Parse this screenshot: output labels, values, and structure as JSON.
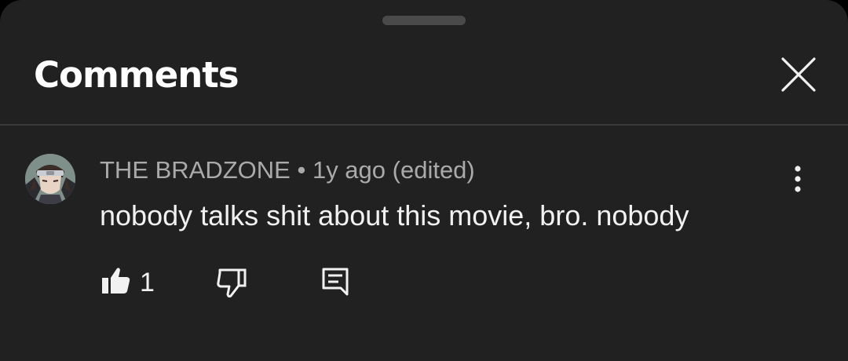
{
  "header": {
    "title": "Comments"
  },
  "icons": {
    "close": "close-icon",
    "more": "more-vert-icon",
    "like": "thumbs-up-icon",
    "dislike": "thumbs-down-icon",
    "reply": "comment-reply-icon"
  },
  "comment": {
    "author": "THE BRADZONE",
    "separator": " • ",
    "time": "1y ago (edited)",
    "text": "nobody talks shit about this movie, bro. nobody",
    "likes": "1"
  },
  "colors": {
    "sheet_background": "#212121",
    "text_primary": "#f1f1f1",
    "text_secondary": "#aaaaaa"
  }
}
